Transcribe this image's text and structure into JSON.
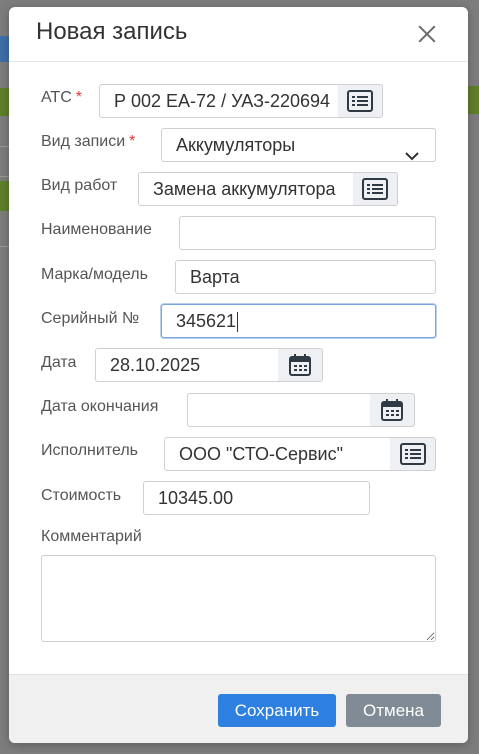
{
  "dialog": {
    "title": "Новая запись",
    "close_icon": "close-icon"
  },
  "form": {
    "ats": {
      "label": "АТС",
      "required_mark": "*",
      "value": "Р 002 ЕА-72 / УАЗ-220694",
      "addon_icon": "list-icon"
    },
    "record_type": {
      "label": "Вид записи",
      "required_mark": "*",
      "value": "Аккумуляторы",
      "icon": "chevron-down-icon"
    },
    "work_type": {
      "label": "Вид работ",
      "value": "Замена аккумулятора",
      "addon_icon": "list-icon"
    },
    "name": {
      "label": "Наименование",
      "value": ""
    },
    "brand_model": {
      "label": "Марка/модель",
      "value": "Варта"
    },
    "serial": {
      "label": "Серийный №",
      "value": "345621"
    },
    "date": {
      "label": "Дата",
      "value": "28.10.2025",
      "addon_icon": "calendar-icon"
    },
    "end_date": {
      "label": "Дата окончания",
      "value": "",
      "addon_icon": "calendar-icon"
    },
    "executor": {
      "label": "Исполнитель",
      "value": "ООО \"СТО-Сервис\"",
      "addon_icon": "list-icon"
    },
    "cost": {
      "label": "Стоимость",
      "value": "10345.00"
    },
    "comment": {
      "label": "Комментарий",
      "value": ""
    }
  },
  "footer": {
    "save_label": "Сохранить",
    "cancel_label": "Отмена"
  },
  "colors": {
    "primary": "#2d7fe0",
    "secondary": "#808b96",
    "required": "#e03a3a",
    "focus_border": "#7ba6df"
  }
}
